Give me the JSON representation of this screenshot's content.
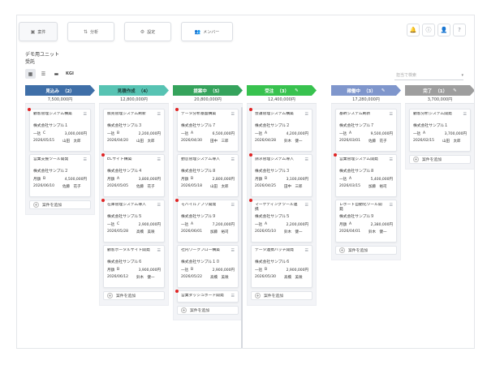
{
  "tabs": [
    {
      "label": "案件",
      "icon": "briefcase-icon",
      "glyph": "▣",
      "active": true
    },
    {
      "label": "分析",
      "icon": "chart-icon",
      "glyph": "⇅",
      "active": false
    },
    {
      "label": "設定",
      "icon": "settings-icon",
      "glyph": "⚙",
      "active": false
    },
    {
      "label": "メンバー",
      "icon": "people-icon",
      "glyph": "👥",
      "active": false
    }
  ],
  "header_icons": [
    {
      "name": "bell-icon",
      "glyph": "🔔"
    },
    {
      "name": "info-icon",
      "glyph": "ⓘ"
    },
    {
      "name": "user-icon",
      "glyph": "👤"
    },
    {
      "name": "help-icon",
      "glyph": "?"
    }
  ],
  "unit_title": "デモ用ユニット",
  "unit_subtitle": "受託",
  "view": {
    "kgi_label": "KGI"
  },
  "search": {
    "placeholder": "担当で検索"
  },
  "add_label": "案件を追加",
  "columns": [
    {
      "name": "見込み",
      "count": "（2）",
      "total": "7,500,000円",
      "color": "#3f6fa8",
      "text_color": "#ffffff",
      "edit": false,
      "cards": [
        {
          "title": "顧客管理システム構築",
          "client": "株式会社サンプル１",
          "rank": "一括",
          "grade": "C",
          "amount": "3,000,000円",
          "date": "2026/05/15",
          "owner": "山田　太郎",
          "alert": true
        },
        {
          "title": "営業支援ツール開発",
          "client": "株式会社サンプル２",
          "rank": "月額",
          "grade": "B",
          "amount": "4,500,000円",
          "date": "2026/06/10",
          "owner": "佐藤　花子",
          "alert": false
        }
      ]
    },
    {
      "name": "見積作成",
      "count": "（4）",
      "total": "12,800,000円",
      "color": "#57c3b3",
      "text_color": "#1c3d38",
      "edit": false,
      "cards": [
        {
          "title": "販売管理システム刷新",
          "client": "株式会社サンプル３",
          "rank": "一括",
          "grade": "B",
          "amount": "2,200,000円",
          "date": "2026/04/20",
          "owner": "山田　太郎",
          "alert": false
        },
        {
          "title": "ECサイト構築",
          "client": "株式会社サンプル４",
          "rank": "月額",
          "grade": "A",
          "amount": "3,800,000円",
          "date": "2026/05/05",
          "owner": "佐藤　花子",
          "alert": true
        },
        {
          "title": "在庫管理システム導入",
          "client": "株式会社サンプル５",
          "rank": "一括",
          "grade": "C",
          "amount": "2,900,000円",
          "date": "2026/05/28",
          "owner": "高橋　美咲",
          "alert": true
        },
        {
          "title": "顧客ポータルサイト開発",
          "client": "株式会社サンプル６",
          "rank": "月額",
          "grade": "B",
          "amount": "3,900,000円",
          "date": "2026/06/12",
          "owner": "鈴木　健一",
          "alert": false
        }
      ]
    },
    {
      "name": "提案中",
      "count": "（5）",
      "total": "20,800,000円",
      "color": "#35a35c",
      "text_color": "#ffffff",
      "edit": false,
      "cards": [
        {
          "title": "データ分析基盤構築",
          "client": "株式会社サンプル７",
          "rank": "一括",
          "grade": "A",
          "amount": "6,500,000円",
          "date": "2026/04/30",
          "owner": "田中　三郎",
          "alert": true
        },
        {
          "title": "勤怠管理システム導入",
          "client": "株式会社サンプル８",
          "rank": "月額",
          "grade": "B",
          "amount": "2,800,000円",
          "date": "2026/05/18",
          "owner": "山田　太郎",
          "alert": false
        },
        {
          "title": "モバイルアプリ開発",
          "client": "株式会社サンプル９",
          "rank": "一括",
          "grade": "A",
          "amount": "7,200,000円",
          "date": "2026/06/01",
          "owner": "加藤　裕司",
          "alert": true
        },
        {
          "title": "社内ワークフロー構築",
          "client": "株式会社サンプル１０",
          "rank": "一括",
          "grade": "B",
          "amount": "2,900,000円",
          "date": "2026/05/22",
          "owner": "高橋　美咲",
          "alert": false
        },
        {
          "title": "営業ダッシュボード開発",
          "client": "",
          "rank": "",
          "grade": "",
          "amount": "",
          "date": "",
          "owner": "",
          "alert": true
        }
      ]
    },
    {
      "name": "受注",
      "count": "（3）",
      "total": "12,400,000円",
      "color": "#38c24f",
      "text_color": "#ffffff",
      "edit": true,
      "cards": [
        {
          "title": "会議管理システム構築",
          "client": "株式会社サンプル２",
          "rank": "一括",
          "grade": "A",
          "amount": "4,200,000円",
          "date": "2026/04/28",
          "owner": "鈴木　健一",
          "alert": true
        },
        {
          "title": "請求管理システム導入",
          "client": "株式会社サンプル３",
          "rank": "月額",
          "grade": "B",
          "amount": "3,100,000円",
          "date": "2026/04/25",
          "owner": "田中　三郎",
          "alert": true
        },
        {
          "title": "マーケティングツール連携",
          "client": "株式会社サンプル５",
          "rank": "一括",
          "grade": "A",
          "amount": "2,200,000円",
          "date": "2026/05/10",
          "owner": "鈴木　健一",
          "alert": true
        },
        {
          "title": "データ連携バッチ開発",
          "client": "株式会社サンプル６",
          "rank": "一括",
          "grade": "B",
          "amount": "2,900,000円",
          "date": "2026/05/30",
          "owner": "高橋　美咲",
          "alert": false
        }
      ]
    },
    {
      "name": "稼働中",
      "count": "（3）",
      "total": "17,280,000円",
      "color": "#7f96cc",
      "text_color": "#ffffff",
      "edit": true,
      "cards": [
        {
          "title": "基幹システム刷新",
          "client": "株式会社サンプル７",
          "rank": "一括",
          "grade": "A",
          "amount": "9,500,000円",
          "date": "2026/03/01",
          "owner": "佐藤　花子",
          "alert": false
        },
        {
          "title": "営業管理システム開発",
          "client": "株式会社サンプル８",
          "rank": "一括",
          "grade": "A",
          "amount": "5,400,000円",
          "date": "2026/03/15",
          "owner": "加藤　裕司",
          "alert": true
        },
        {
          "title": "レポート自動化ツール開発",
          "client": "株式会社サンプル９",
          "rank": "月額",
          "grade": "A",
          "amount": "2,380,000円",
          "date": "2026/04/01",
          "owner": "鈴木　健一",
          "alert": false
        }
      ]
    },
    {
      "name": "完了",
      "count": "（1）",
      "total": "3,700,000円",
      "color": "#9e9e9e",
      "text_color": "#ffffff",
      "edit": true,
      "cards": [
        {
          "title": "顧客分析システム開発",
          "client": "株式会社サンプル１",
          "rank": "一括",
          "grade": "A",
          "amount": "3,700,000円",
          "date": "2026/02/15",
          "owner": "山田　太郎",
          "alert": false
        }
      ]
    }
  ]
}
